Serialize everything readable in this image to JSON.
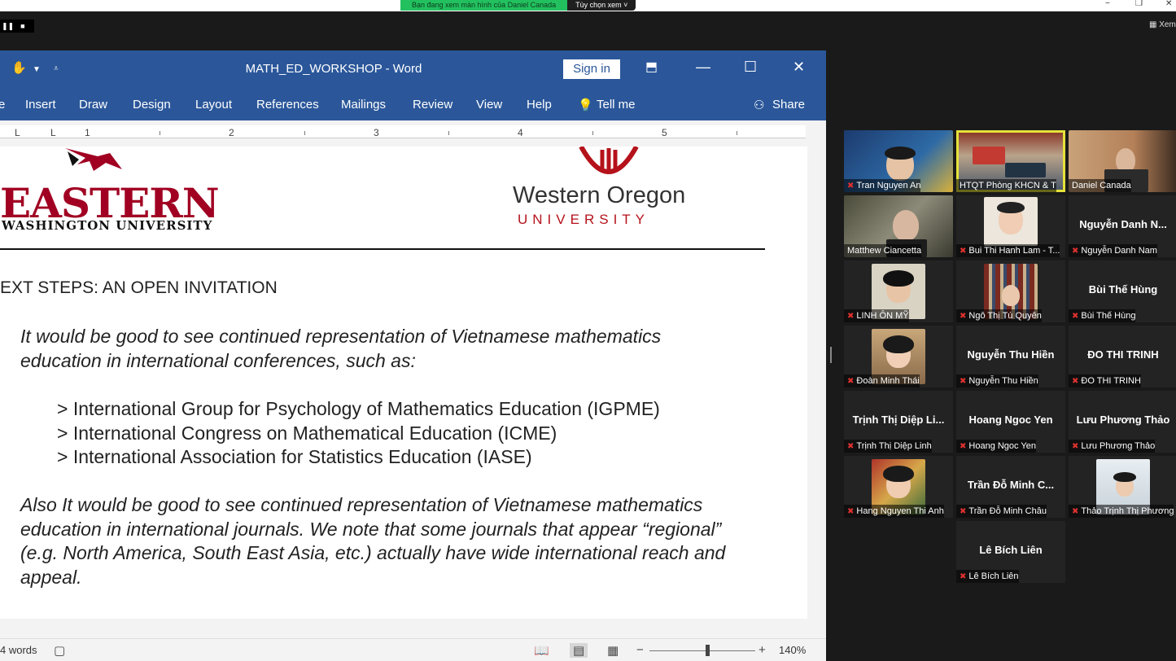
{
  "zoom": {
    "share_banner": "Bạn đang xem màn hình của Daniel Canada",
    "view_options": "Tùy chọn xem ˅",
    "view_button": "Xem",
    "win_min": "−",
    "win_max": "❐",
    "win_close": "✕"
  },
  "word": {
    "title": "MATH_ED_WORKSHOP  -  Word",
    "sign_in": "Sign in",
    "tabs": [
      "e",
      "Insert",
      "Draw",
      "Design",
      "Layout",
      "References",
      "Mailings",
      "Review",
      "View",
      "Help",
      "Tell me"
    ],
    "share": "Share",
    "ruler_numbers": [
      "1",
      "2",
      "3",
      "4",
      "5"
    ],
    "document": {
      "ewu_name": "EASTERN",
      "ewu_sub": "WASHINGTON UNIVERSITY",
      "wou_name": "Western Oregon",
      "wou_sub": "UNIVERSITY",
      "heading": "EXT STEPS: AN OPEN INVITATION",
      "para1_line1": "It would be good to see continued representation of Vietnamese mathematics",
      "para1_line2": "education in international conferences, such as:",
      "bullets": [
        "> International Group for Psychology of Mathematics Education (IGPME)",
        "> International Congress on Mathematical Education (ICME)",
        "> International Association for Statistics Education (IASE)"
      ],
      "para2_lines": [
        "Also It would be good to see continued representation of Vietnamese mathematics",
        "education in international journals. We note that some journals that appear “regional”",
        "(e.g. North America, South East Asia, etc.) actually have wide international reach and",
        "appeal."
      ]
    },
    "status": {
      "words": "4 words",
      "zoom_level": "140%",
      "zoom_minus": "−",
      "zoom_plus": "+"
    }
  },
  "participants": [
    {
      "label": "Tran Nguyen An",
      "center": ""
    },
    {
      "label": "HTQT Phòng KHCN & T",
      "center": "",
      "active": true
    },
    {
      "label": "Daniel Canada",
      "center": ""
    },
    {
      "label": "Matthew Ciancetta",
      "center": ""
    },
    {
      "label": "Bui Thi Hanh Lam - T...",
      "center": ""
    },
    {
      "label": "Nguyễn Danh Nam",
      "center": "Nguyễn Danh N..."
    },
    {
      "label": "LINH ÔN MỸ",
      "center": ""
    },
    {
      "label": "Ngô Thị Tú Quyên",
      "center": ""
    },
    {
      "label": "Bùi Thế Hùng",
      "center": "Bùi Thế Hùng"
    },
    {
      "label": "Đoàn Minh Thái",
      "center": ""
    },
    {
      "label": "Nguyễn Thu Hiền",
      "center": "Nguyễn Thu Hiền"
    },
    {
      "label": "ĐO THI TRINH",
      "center": "ĐO THI TRINH"
    },
    {
      "label": "Trịnh Thị Diệp Linh",
      "center": "Trịnh Thị Diệp Li..."
    },
    {
      "label": "Hoang Ngoc Yen",
      "center": "Hoang Ngoc Yen"
    },
    {
      "label": "Lưu Phương Thảo",
      "center": "Lưu Phương Thảo"
    },
    {
      "label": "Hang Nguyen Thi Anh",
      "center": ""
    },
    {
      "label": "Trần Đỗ Minh Châu",
      "center": "Trần Đỗ Minh C..."
    },
    {
      "label": "Thảo Trịnh Thị Phương",
      "center": ""
    },
    {
      "label": "Lê Bích Liên",
      "center": "Lê Bích Liên"
    }
  ]
}
